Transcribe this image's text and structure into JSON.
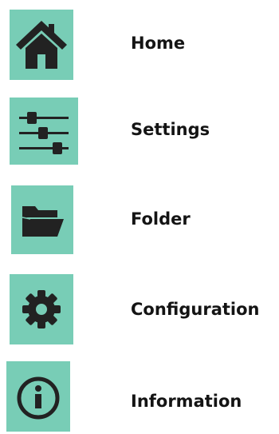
{
  "colors": {
    "tile_background": "#78cdb6",
    "icon_fill": "#222222",
    "label_text": "#141414"
  },
  "nav": {
    "items": [
      {
        "label": "Home",
        "icon": "home-icon"
      },
      {
        "label": "Settings",
        "icon": "sliders-icon"
      },
      {
        "label": "Folder",
        "icon": "folder-icon"
      },
      {
        "label": "Configuration",
        "icon": "gear-icon"
      },
      {
        "label": "Information",
        "icon": "info-icon"
      }
    ]
  }
}
